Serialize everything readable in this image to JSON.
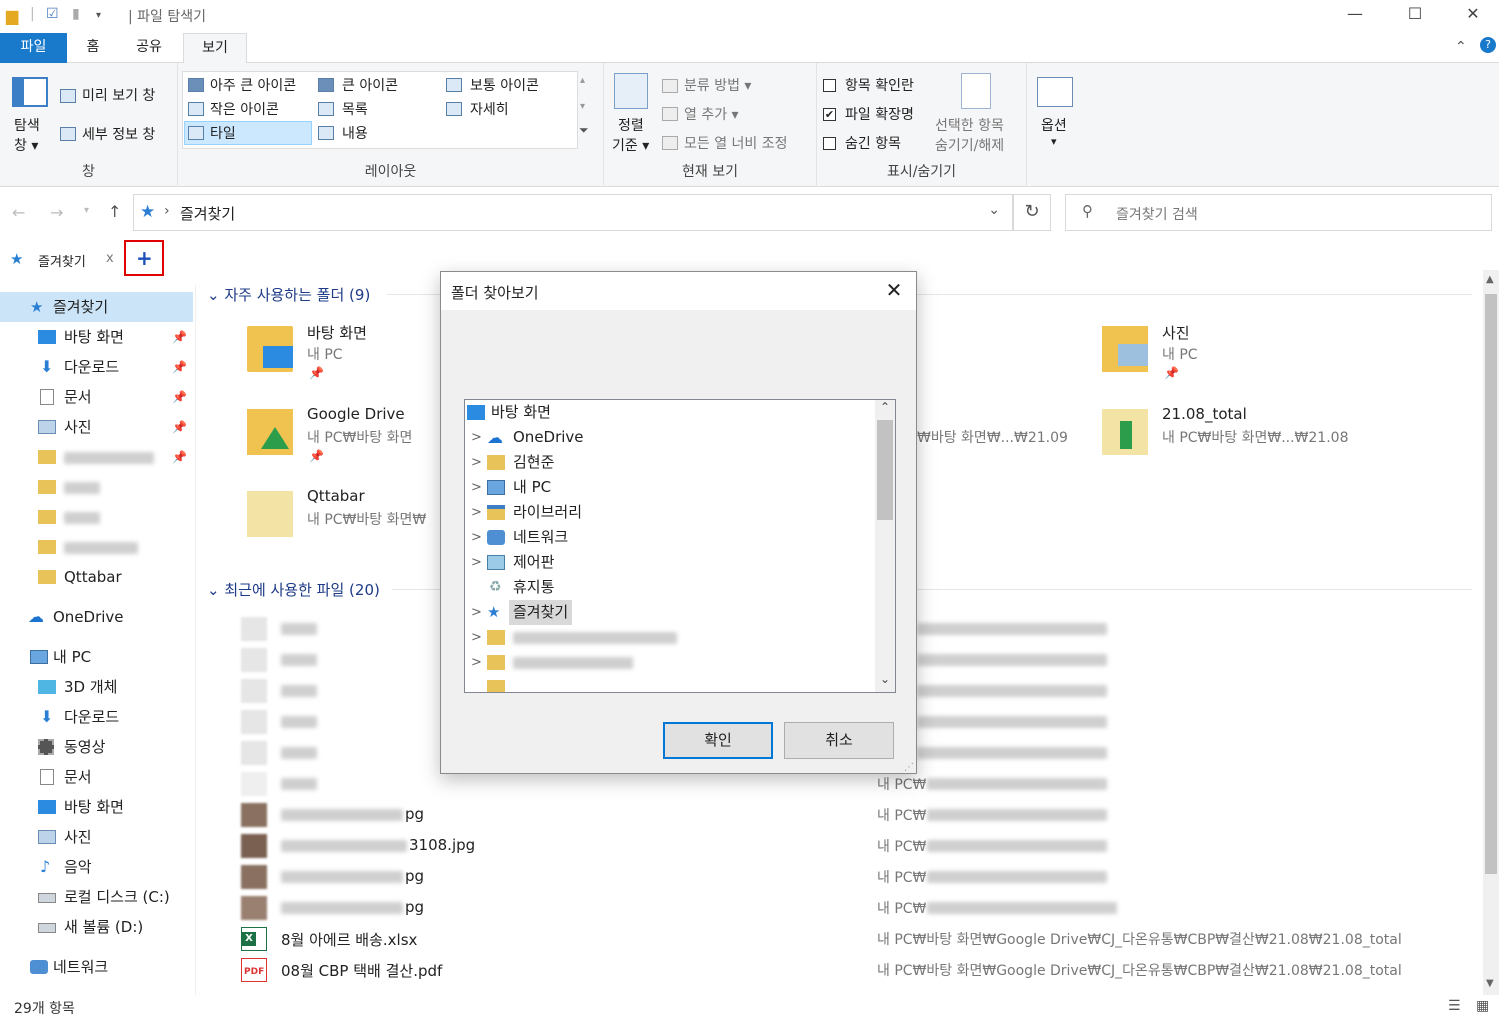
{
  "window": {
    "title": "| 파일 탐색기",
    "minimize": "—",
    "maximize": "☐",
    "close": "✕"
  },
  "ribbon_tabs": [
    "파일",
    "홈",
    "공유",
    "보기"
  ],
  "ribbon": {
    "pane": {
      "nav_pane": "탐색",
      "nav_pane2": "창 ▾",
      "preview": "미리 보기 창",
      "details": "세부 정보 창",
      "label": "창"
    },
    "layout": {
      "xl_icons": "아주 큰 아이콘",
      "l_icons": "큰 아이콘",
      "m_icons": "보통 아이콘",
      "s_icons": "작은 아이콘",
      "list": "목록",
      "details": "자세히",
      "tiles": "타일",
      "content": "내용",
      "label": "레이아웃"
    },
    "current_view": {
      "sort": "정렬",
      "sort2": "기준 ▾",
      "group_by": "분류 방법 ▾",
      "add_col": "열 추가 ▾",
      "fit_cols": "모든 열 너비 조정",
      "label": "현재 보기"
    },
    "show_hide": {
      "item_checkboxes": "항목 확인란",
      "file_ext": "파일 확장명",
      "hidden": "숨긴 항목",
      "hide_selected": "선택한 항목",
      "hide_selected2": "숨기기/해제",
      "label": "표시/숨기기"
    },
    "options": {
      "label": "옵션",
      "arrow": "▾"
    }
  },
  "address": {
    "path": "즐겨찾기",
    "search_placeholder": "즐겨찾기 검색"
  },
  "tabbar": {
    "tab": "즐겨찾기",
    "close": "x",
    "add": "+"
  },
  "nav": {
    "quick_access": "즐겨찾기",
    "pinned": [
      "바탕 화면",
      "다운로드",
      "문서",
      "사진"
    ],
    "qttabar": "Qttabar",
    "onedrive": "OneDrive",
    "this_pc": "내 PC",
    "pc_items": [
      "3D 개체",
      "다운로드",
      "동영상",
      "문서",
      "바탕 화면",
      "사진",
      "음악",
      "로컬 디스크 (C:)",
      "새 볼륨 (D:)"
    ],
    "network": "네트워크"
  },
  "content": {
    "frequent_header": "자주 사용하는 폴더 (9)",
    "recent_header": "최근에 사용한 파일 (20)",
    "folders": [
      {
        "name": "바탕 화면",
        "sub": "내 PC"
      },
      {
        "name": "사진",
        "sub": "내 PC"
      },
      {
        "name": "Google Drive",
        "sub": "내 PC₩바탕 화면"
      },
      {
        "name": "21.08_total",
        "sub": "내 PC₩바탕 화면₩...₩21.08"
      },
      {
        "name": "Qttabar",
        "sub": "내 PC₩바탕 화면₩"
      },
      {
        "name": "",
        "sub": "₩바탕 화면₩...₩21.09"
      }
    ],
    "recent_paths_prefix": "내 PC₩",
    "recent_visible": [
      {
        "name": "pg",
        "path": "내 PC₩"
      },
      {
        "name": "3108.jpg",
        "path": "내 PC₩"
      },
      {
        "name": "pg",
        "path": "내 PC₩"
      },
      {
        "name": "pg",
        "path": "내 PC₩"
      },
      {
        "name": "8월 아에르 배송.xlsx",
        "path": "내 PC₩바탕 화면₩Google Drive₩CJ_다온유통₩CBP₩결산₩21.08₩21.08_total"
      },
      {
        "name": "08월 CBP 택배 결산.pdf",
        "path": "내 PC₩바탕 화면₩Google Drive₩CJ_다온유통₩CBP₩결산₩21.08₩21.08_total"
      }
    ]
  },
  "status": {
    "count": "29개 항목"
  },
  "dialog": {
    "title": "폴더 찾아보기",
    "close": "✕",
    "tree": [
      {
        "label": "바탕 화면",
        "expand": ""
      },
      {
        "label": "OneDrive",
        "expand": ">"
      },
      {
        "label": "김현준",
        "expand": ">"
      },
      {
        "label": "내 PC",
        "expand": ">"
      },
      {
        "label": "라이브러리",
        "expand": ">"
      },
      {
        "label": "네트워크",
        "expand": ">"
      },
      {
        "label": "제어판",
        "expand": ">"
      },
      {
        "label": "휴지통",
        "expand": ""
      },
      {
        "label": "즐겨찾기",
        "expand": ">"
      }
    ],
    "ok": "확인",
    "cancel": "취소"
  }
}
